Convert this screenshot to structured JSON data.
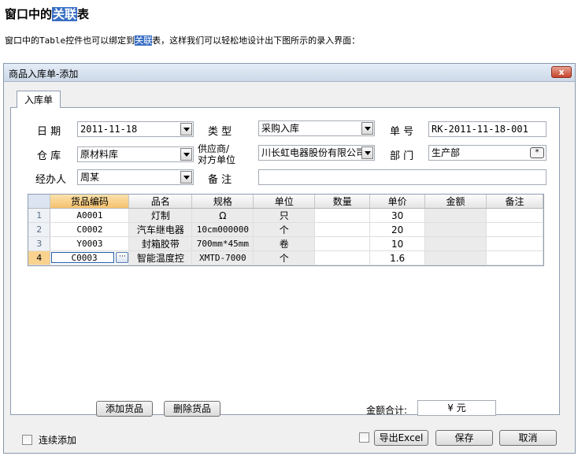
{
  "page": {
    "heading_before": "窗口中的",
    "heading_highlight": "关联",
    "heading_after": "表",
    "intro_before": "窗口中的",
    "intro_code": "Table",
    "intro_mid": "控件也可以绑定到",
    "intro_highlight": "关联",
    "intro_after": "表，这样我们可以轻松地设计出下图所示的录入界面："
  },
  "window": {
    "title": "商品入库单-添加",
    "close_glyph": "x"
  },
  "tab": {
    "label": "入库单"
  },
  "form": {
    "date_label": "日 期",
    "date_value": "2011-11-18",
    "type_label": "类 型",
    "type_value": "采购入库",
    "number_label": "单 号",
    "number_value": "RK-2011-11-18-001",
    "warehouse_label": "仓 库",
    "warehouse_value": "原材料库",
    "supplier_label_line1": "供应商/",
    "supplier_label_line2": "对方单位",
    "supplier_value": "川长虹电器股份有限公司",
    "dept_label": "部 门",
    "dept_value": "生产部",
    "dept_button": "*",
    "handler_label": "经办人",
    "handler_value": "周某",
    "remark_label": "备 注",
    "remark_value": ""
  },
  "grid": {
    "columns": [
      "货品编码",
      "品名",
      "规格",
      "单位",
      "数量",
      "单价",
      "金额",
      "备注"
    ],
    "rows": [
      {
        "num": "1",
        "code": "A0001",
        "name": "灯制",
        "spec": "Ω",
        "unit": "只",
        "qty": "",
        "price": "30",
        "amount": "",
        "note": ""
      },
      {
        "num": "2",
        "code": "C0002",
        "name": "汽车继电器",
        "spec": "10cm000000",
        "unit": "个",
        "qty": "",
        "price": "20",
        "amount": "",
        "note": ""
      },
      {
        "num": "3",
        "code": "Y0003",
        "name": "封箱胶带",
        "spec": "700mm*45mm",
        "unit": "卷",
        "qty": "",
        "price": "10",
        "amount": "",
        "note": ""
      },
      {
        "num": "4",
        "code": "C0003",
        "name": "智能温度控",
        "spec": "XMTD-7000",
        "unit": "个",
        "qty": "",
        "price": "1.6",
        "amount": "",
        "note": ""
      }
    ],
    "ellipsis": "···"
  },
  "footer": {
    "add_goods": "添加货品",
    "delete_goods": "删除货品",
    "total_label": "金额合计:",
    "total_value": "¥  元",
    "continuous_add": "连续添加",
    "export_excel": "导出Excel",
    "save": "保存",
    "cancel": "取消"
  }
}
